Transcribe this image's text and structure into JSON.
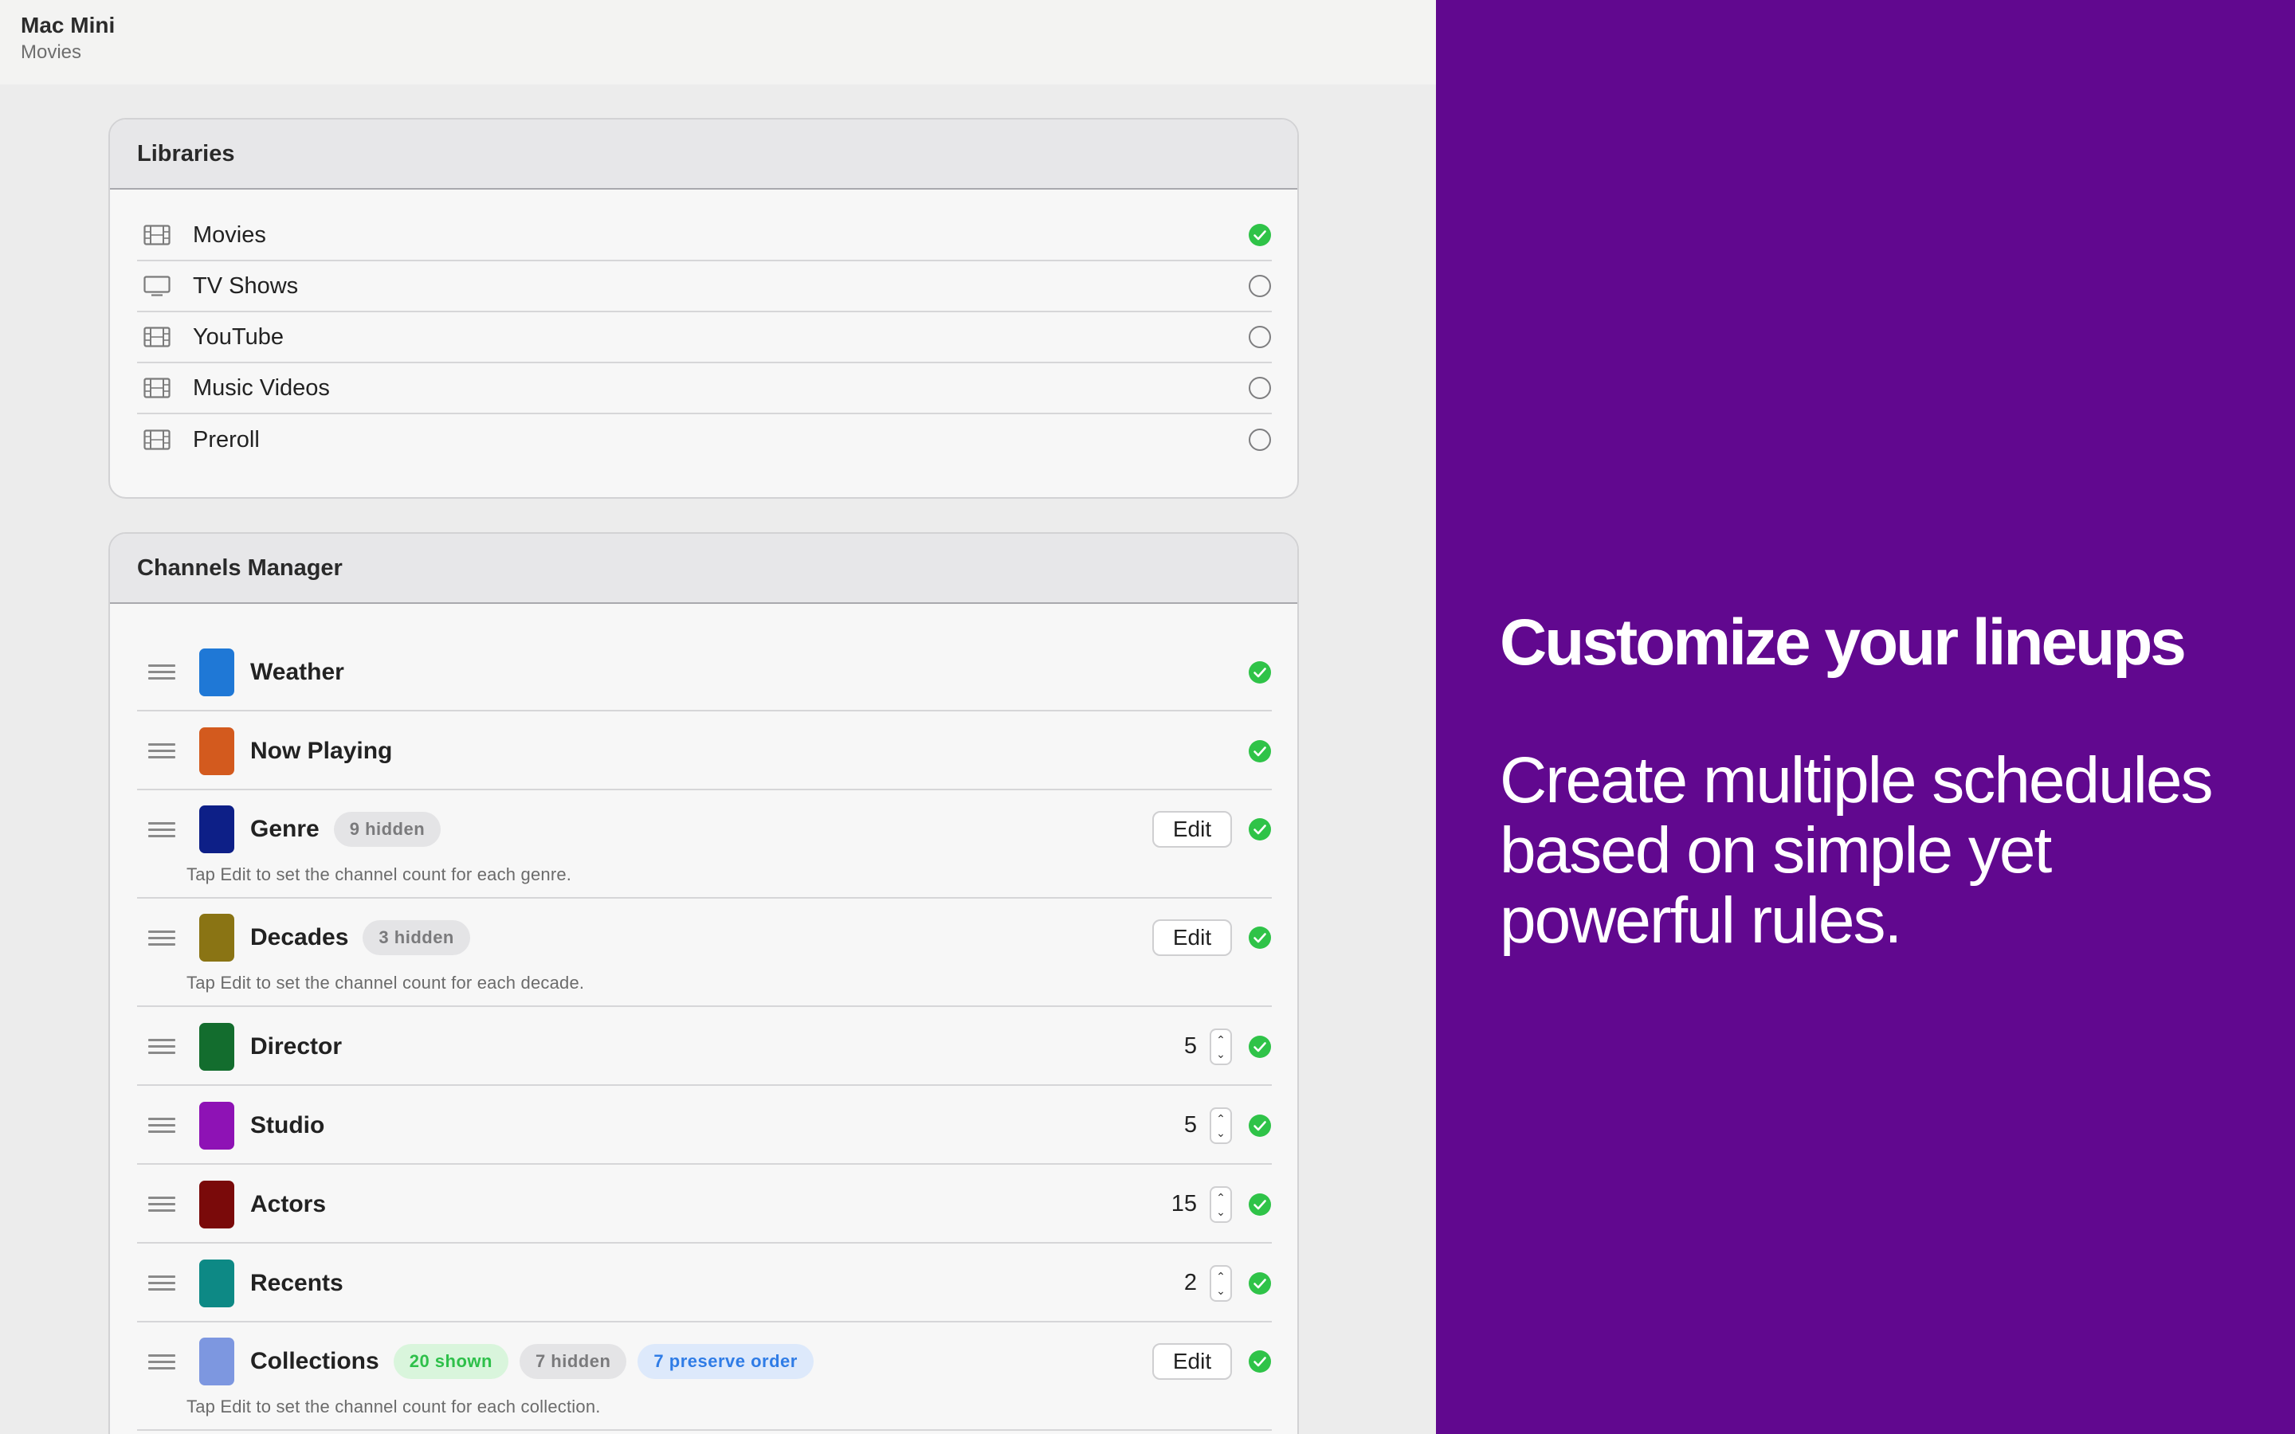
{
  "window": {
    "title": "Mac Mini",
    "subtitle": "Movies"
  },
  "libraries": {
    "header": "Libraries",
    "items": [
      {
        "label": "Movies",
        "icon": "film-icon",
        "selected": true
      },
      {
        "label": "TV Shows",
        "icon": "tv-icon",
        "selected": false
      },
      {
        "label": "YouTube",
        "icon": "film-icon",
        "selected": false
      },
      {
        "label": "Music Videos",
        "icon": "film-icon",
        "selected": false
      },
      {
        "label": "Preroll",
        "icon": "film-icon",
        "selected": false
      }
    ]
  },
  "channels": {
    "header": "Channels Manager",
    "edit_label": "Edit",
    "items": [
      {
        "label": "Weather",
        "color": "#1f78d6",
        "enabled": true
      },
      {
        "label": "Now Playing",
        "color": "#d35a1e",
        "enabled": true
      },
      {
        "label": "Genre",
        "color": "#0d1f87",
        "enabled": true,
        "badges": [
          "9 hidden"
        ],
        "hint": "Tap Edit to set the channel count for each genre."
      },
      {
        "label": "Decades",
        "color": "#8a7414",
        "enabled": true,
        "badges": [
          "3 hidden"
        ],
        "hint": "Tap Edit to set the channel count for each decade."
      },
      {
        "label": "Director",
        "color": "#136d2e",
        "enabled": true,
        "count": "5"
      },
      {
        "label": "Studio",
        "color": "#8e12b5",
        "enabled": true,
        "count": "5"
      },
      {
        "label": "Actors",
        "color": "#7a0a0a",
        "enabled": true,
        "count": "15"
      },
      {
        "label": "Recents",
        "color": "#0d8985",
        "enabled": true,
        "count": "2"
      },
      {
        "label": "Collections",
        "color": "#7d97e0",
        "enabled": true,
        "badges": [
          "20 shown",
          "7 hidden",
          "7 preserve order"
        ],
        "hint": "Tap Edit to set the channel count for each collection."
      }
    ]
  },
  "promo": {
    "title": "Customize your lineups",
    "body": "Create multiple schedules based on simple yet powerful rules.",
    "background": "#61088f"
  },
  "colors": {
    "check_green": "#2fc348",
    "badge_green": "#2ec04a",
    "badge_blue": "#2f7ce6"
  }
}
